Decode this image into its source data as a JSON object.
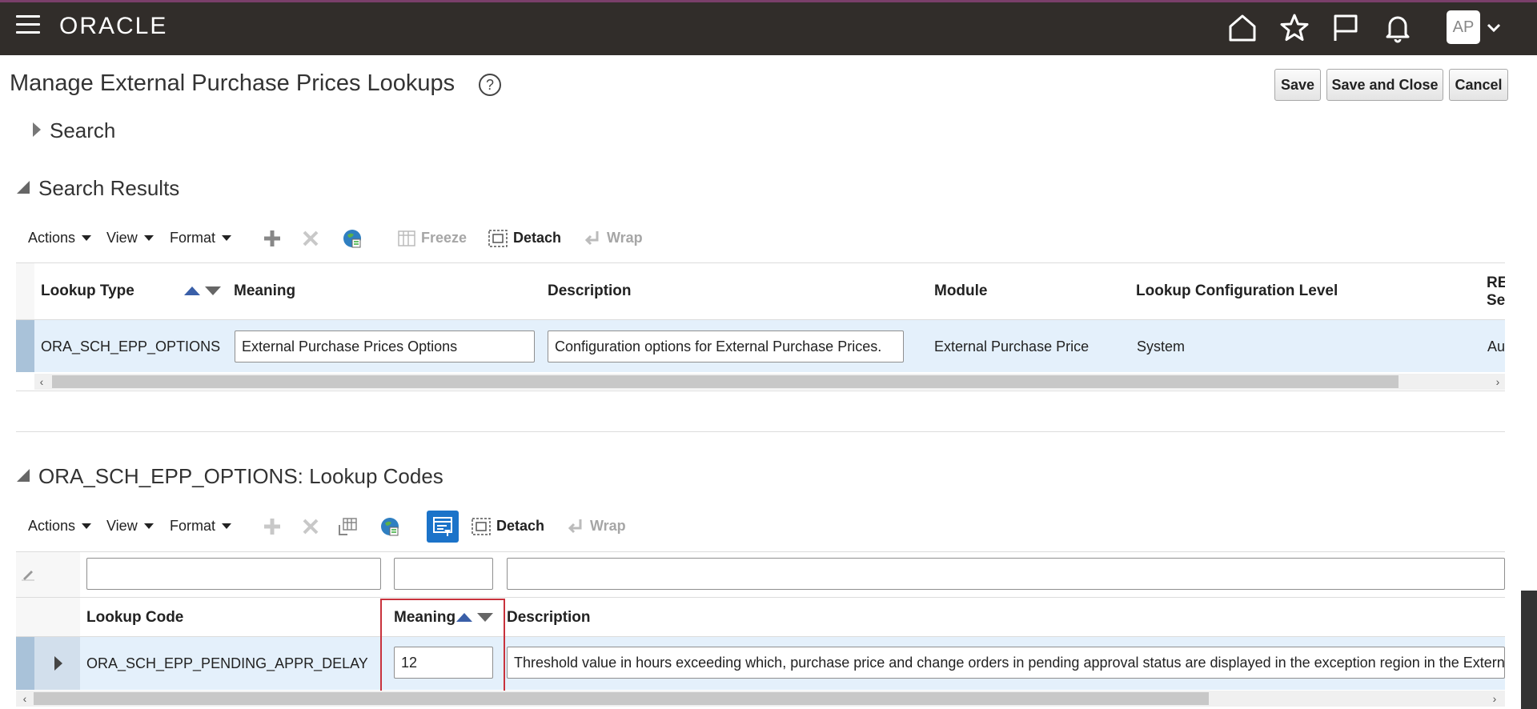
{
  "header": {
    "brand": "ORACLE",
    "avatar_initials": "AP",
    "icons": [
      "hamburger-icon",
      "home-icon",
      "star-icon",
      "flag-icon",
      "bell-icon",
      "chevron-down-icon"
    ],
    "colors": {
      "bar": "#312d2a",
      "accent_line": "#7a3f6a"
    }
  },
  "page": {
    "title": "Manage External Purchase Prices Lookups",
    "help": "?",
    "buttons": {
      "save": "Save",
      "save_close": "Save and Close",
      "cancel": "Cancel"
    }
  },
  "search": {
    "title": "Search"
  },
  "results": {
    "title": "Search Results",
    "toolbar": {
      "actions": "Actions",
      "view": "View",
      "format": "Format",
      "freeze": "Freeze",
      "detach": "Detach",
      "wrap": "Wrap"
    },
    "columns": [
      "Lookup Type",
      "Meaning",
      "Description",
      "Module",
      "Lookup Configuration Level",
      "RE",
      "Se"
    ],
    "row": {
      "lookup_type": "ORA_SCH_EPP_OPTIONS",
      "meaning": "External Purchase Prices Options",
      "description": "Configuration options for External Purchase Prices.",
      "module": "External Purchase Price",
      "level": "System",
      "extra": "Au"
    }
  },
  "codes": {
    "title": "ORA_SCH_EPP_OPTIONS: Lookup Codes",
    "toolbar": {
      "actions": "Actions",
      "view": "View",
      "format": "Format",
      "detach": "Detach",
      "wrap": "Wrap"
    },
    "filters": {
      "lookup_code": "",
      "meaning": "",
      "description": ""
    },
    "columns": [
      "Lookup Code",
      "Meaning",
      "Description"
    ],
    "row": {
      "lookup_code": "ORA_SCH_EPP_PENDING_APPR_DELAY",
      "meaning": "12",
      "description": "Threshold value in hours exceeding which, purchase price and change orders in pending approval status are displayed in the exception region in the Externa"
    },
    "colors": {
      "highlight": "#c8323c",
      "selected_row": "#e4f0fb",
      "query_button": "#1b73c9"
    }
  }
}
